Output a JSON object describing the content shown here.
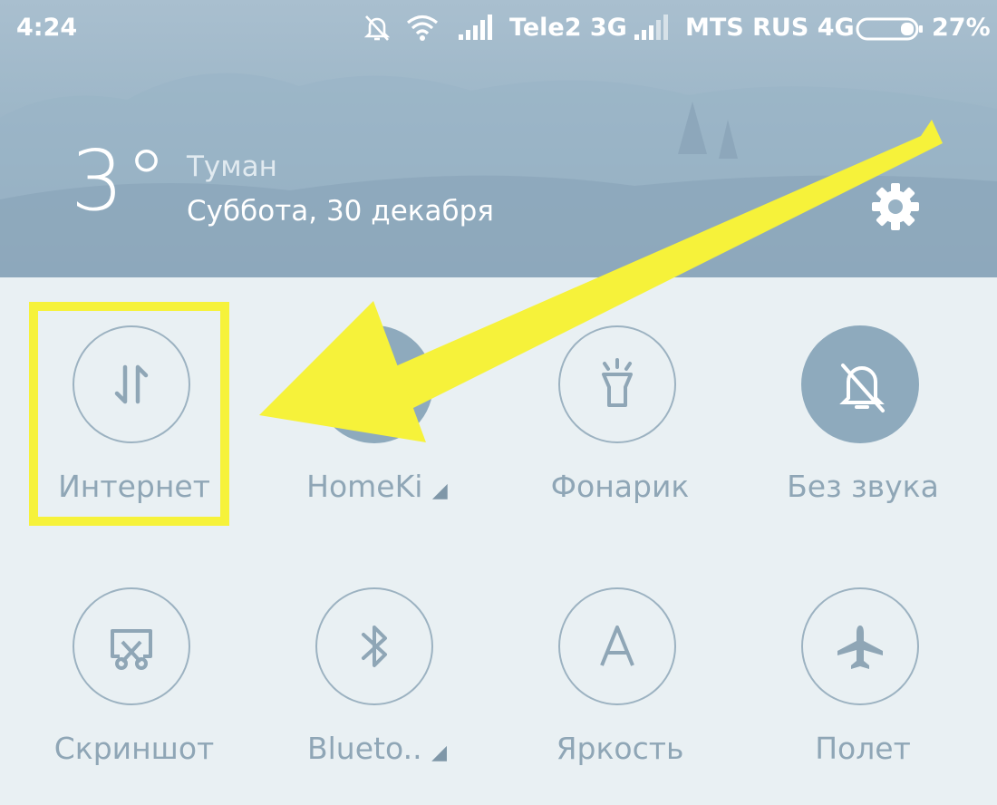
{
  "status_bar": {
    "time": "4:24",
    "carrier1": "Tele2 3G",
    "carrier2": "MTS RUS 4G",
    "battery": "27%",
    "icons": [
      "bell-off-icon",
      "wifi-icon",
      "signal-icon",
      "signal-icon",
      "battery-icon"
    ]
  },
  "weather": {
    "temperature": "3°",
    "condition": "Туман",
    "date": "Суббота, 30 декабря"
  },
  "header_actions": [
    "more-icon",
    "gear-icon"
  ],
  "tiles": [
    {
      "label": "Интернет",
      "icon": "mobile-data-icon",
      "active": false,
      "dropdown": false
    },
    {
      "label": "HomeKi",
      "icon": "wifi-icon",
      "active": true,
      "dropdown": true
    },
    {
      "label": "Фонарик",
      "icon": "flashlight-icon",
      "active": false,
      "dropdown": false
    },
    {
      "label": "Без звука",
      "icon": "bell-off-icon",
      "active": true,
      "dropdown": false
    },
    {
      "label": "Скриншот",
      "icon": "screenshot-icon",
      "active": false,
      "dropdown": false
    },
    {
      "label": "Blueto..",
      "icon": "bluetooth-icon",
      "active": false,
      "dropdown": true
    },
    {
      "label": "Яркость",
      "icon": "brightness-auto-icon",
      "active": false,
      "dropdown": false
    },
    {
      "label": "Полет",
      "icon": "airplane-icon",
      "active": false,
      "dropdown": false
    }
  ],
  "colors": {
    "highlight": "#f6f23a",
    "tile_active": "#8eaabd",
    "tile_outline": "#9cb2c1"
  }
}
